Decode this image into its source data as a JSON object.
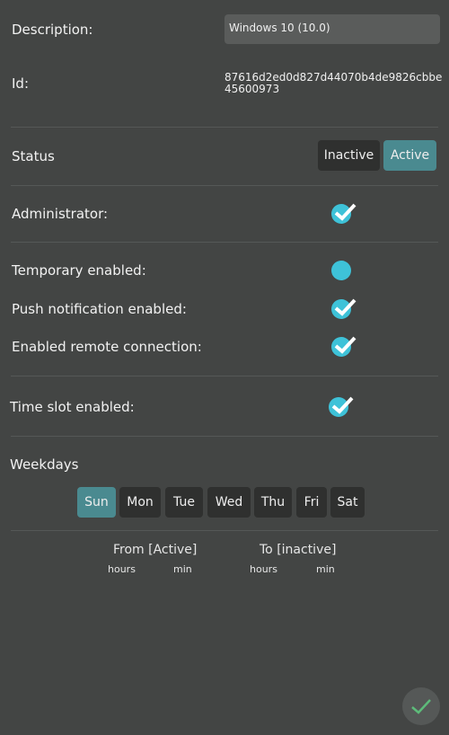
{
  "description": {
    "label": "Description:",
    "value": "Windows 10 (10.0)"
  },
  "id": {
    "label": "Id:",
    "value": "87616d2ed0d827d44070b4de9826cbbe45600973"
  },
  "status": {
    "label": "Status",
    "options": [
      "Inactive",
      "Active"
    ],
    "selected": "Active"
  },
  "options": [
    {
      "label": "Administrator:",
      "checked": true
    },
    {
      "label": "Temporary enabled:",
      "checked": false
    },
    {
      "label": "Push notification enabled:",
      "checked": true
    },
    {
      "label": "Enabled remote connection:",
      "checked": true
    },
    {
      "label": "Time slot enabled:",
      "checked": true
    }
  ],
  "weekdays": {
    "label": "Weekdays",
    "days": [
      "Sun",
      "Mon",
      "Tue",
      "Wed",
      "Thu",
      "Fri",
      "Sat"
    ],
    "selected": [
      "Sun"
    ]
  },
  "time": {
    "from_label": "From [Active]",
    "to_label": "To [inactive]",
    "hours": "hours",
    "min": "min"
  },
  "colors": {
    "accent": "#3ec2d8",
    "selected": "#4a8a90",
    "confirm": "#5dbb7a"
  },
  "confirm_icon": "check-icon"
}
